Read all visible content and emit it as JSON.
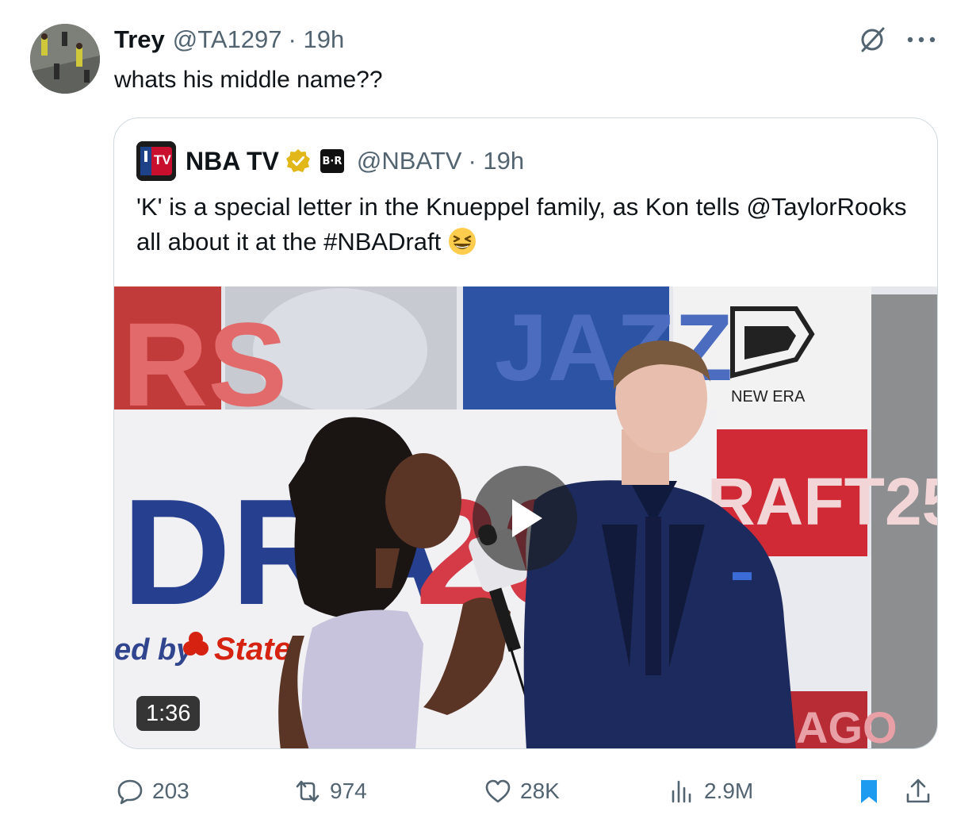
{
  "tweet": {
    "author_name": "Trey",
    "handle": "@TA1297",
    "time": "· 19h",
    "text": "whats his middle name??"
  },
  "quote": {
    "logo_text": "TV",
    "author_name": "NBA TV",
    "br_badge": "B·R",
    "handle": "@NBATV",
    "time": "· 19h",
    "text": "'K' is a special letter in the Knueppel family, as Kon tells @TaylorRooks all about it at the #NBADraft",
    "video": {
      "duration": "1:36",
      "scene_text": {
        "top_left": "RS",
        "jazz": "JAZZ",
        "draft": "DRA",
        "year": "202",
        "new_era": "NEW ERA",
        "draft25": "RAFT25",
        "presented_by": "ed by",
        "statefarm": "State",
        "bottom_right": "AGO"
      }
    }
  },
  "actions": {
    "replies": "203",
    "reposts": "974",
    "likes": "28K",
    "views": "2.9M"
  },
  "colors": {
    "text_primary": "#0f1419",
    "text_secondary": "#536471",
    "border": "#cfd9de",
    "bookmark_active": "#1d9bf0",
    "verified_gold": "#e2b719"
  },
  "icons": {
    "grok": "grok-icon",
    "more": "more-icon",
    "reply": "reply-icon",
    "repost": "repost-icon",
    "like": "heart-icon",
    "views": "views-icon",
    "bookmark": "bookmark-icon",
    "share": "share-icon"
  }
}
